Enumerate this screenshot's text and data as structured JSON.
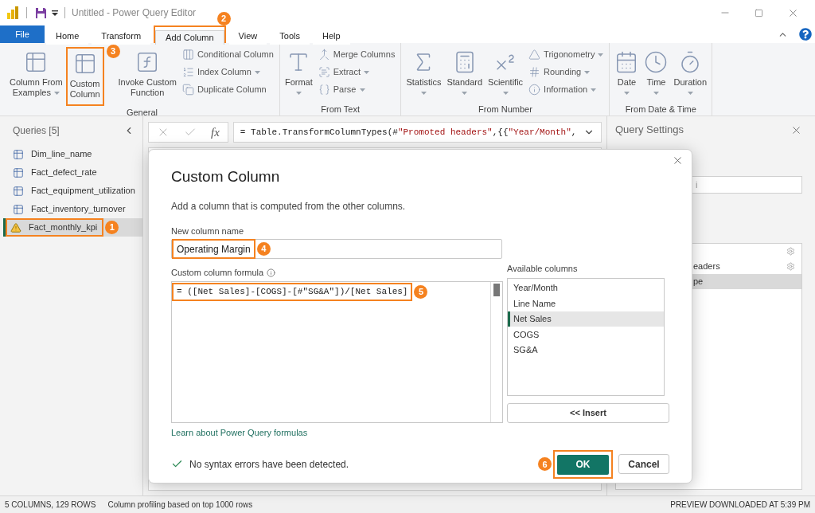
{
  "window": {
    "title": "Untitled - Power Query Editor"
  },
  "ribbon_tabs": [
    {
      "label": "File",
      "kind": "file",
      "selected": false
    },
    {
      "label": "Home",
      "kind": "tab",
      "selected": false
    },
    {
      "label": "Transform",
      "kind": "tab",
      "selected": false
    },
    {
      "label": "Add Column",
      "kind": "tab",
      "selected": true,
      "callout": "2"
    },
    {
      "label": "View",
      "kind": "tab",
      "selected": false
    },
    {
      "label": "Tools",
      "kind": "tab",
      "selected": false
    },
    {
      "label": "Help",
      "kind": "tab",
      "selected": false
    }
  ],
  "ribbon_groups": [
    {
      "label": "General",
      "items": [
        {
          "kind": "large",
          "lines": [
            "Column From",
            "Examples"
          ],
          "dropdown": true
        },
        {
          "kind": "large",
          "lines": [
            "Custom",
            "Column"
          ],
          "dropdown": false,
          "callout": "3"
        },
        {
          "kind": "large",
          "lines": [
            "Invoke Custom",
            "Function"
          ],
          "dropdown": false
        },
        {
          "kind": "stack",
          "buttons": [
            {
              "label": "Conditional Column",
              "dropdown": false
            },
            {
              "label": "Index Column",
              "dropdown": true
            },
            {
              "label": "Duplicate Column",
              "dropdown": false
            }
          ]
        }
      ]
    },
    {
      "label": "From Text",
      "items": [
        {
          "kind": "large",
          "lines": [
            "Format"
          ],
          "dropdown": true
        },
        {
          "kind": "stack",
          "buttons": [
            {
              "label": "Merge Columns",
              "dropdown": false
            },
            {
              "label": "Extract",
              "dropdown": true
            },
            {
              "label": "Parse",
              "dropdown": true
            }
          ]
        }
      ]
    },
    {
      "label": "From Number",
      "items": [
        {
          "kind": "large",
          "lines": [
            "Statistics"
          ],
          "dropdown": true
        },
        {
          "kind": "large",
          "lines": [
            "Standard"
          ],
          "dropdown": true
        },
        {
          "kind": "large",
          "lines": [
            "Scientific"
          ],
          "dropdown": true
        },
        {
          "kind": "stack",
          "buttons": [
            {
              "label": "Trigonometry",
              "dropdown": true
            },
            {
              "label": "Rounding",
              "dropdown": true
            },
            {
              "label": "Information",
              "dropdown": true
            }
          ]
        }
      ]
    },
    {
      "label": "From Date & Time",
      "items": [
        {
          "kind": "large",
          "lines": [
            "Date"
          ],
          "dropdown": true
        },
        {
          "kind": "large",
          "lines": [
            "Time"
          ],
          "dropdown": true
        },
        {
          "kind": "large",
          "lines": [
            "Duration"
          ],
          "dropdown": true
        }
      ]
    }
  ],
  "queries": {
    "title": "Queries [5]",
    "items": [
      {
        "label": "Dim_line_name",
        "kind": "table",
        "selected": false
      },
      {
        "label": "Fact_defect_rate",
        "kind": "table",
        "selected": false
      },
      {
        "label": "Fact_equipment_utilization",
        "kind": "table",
        "selected": false
      },
      {
        "label": "Fact_inventory_turnover",
        "kind": "table",
        "selected": false
      },
      {
        "label": "Fact_monthly_kpi",
        "kind": "warning",
        "selected": true,
        "callout": "1"
      }
    ]
  },
  "formula_bar": {
    "function_label": "fx",
    "segments": [
      {
        "text": "= Table.TransformColumnTypes(#",
        "kind": "code"
      },
      {
        "text": "\"Promoted headers\"",
        "kind": "string"
      },
      {
        "text": ",{{",
        "kind": "code"
      },
      {
        "text": "\"Year/Month\"",
        "kind": "string"
      },
      {
        "text": ",",
        "kind": "code"
      }
    ]
  },
  "query_settings": {
    "title": "Query Settings",
    "name_value": "i",
    "steps": [
      {
        "settings": true,
        "selected": false
      },
      {
        "label": "eaders",
        "settings": true,
        "selected": false
      },
      {
        "label": "pe",
        "settings": false,
        "selected": true
      }
    ]
  },
  "dialog": {
    "title": "Custom Column",
    "description": "Add a column that is computed from the other columns.",
    "name_label": "New column name",
    "name_value": "Operating Margin",
    "name_callout": "4",
    "formula_label": "Custom column formula",
    "formula": "= ([Net Sales]-[COGS]-[#\"SG&A\"])/[Net Sales]",
    "formula_callout": "5",
    "columns_label": "Available columns",
    "columns": [
      {
        "label": "Year/Month",
        "selected": false
      },
      {
        "label": "Line Name",
        "selected": false
      },
      {
        "label": "Net Sales",
        "selected": true
      },
      {
        "label": "COGS",
        "selected": false
      },
      {
        "label": "SG&A",
        "selected": false
      }
    ],
    "insert_button": "<< Insert",
    "link": "Learn about Power Query formulas",
    "validation": "No syntax errors have been detected.",
    "ok_button": "OK",
    "ok_callout": "6",
    "cancel_button": "Cancel"
  },
  "status_bar": {
    "left": [
      "5 COLUMNS, 129 ROWS",
      "Column profiling based on top 1000 rows"
    ],
    "right": "PREVIEW DOWNLOADED AT 5:39 PM"
  }
}
